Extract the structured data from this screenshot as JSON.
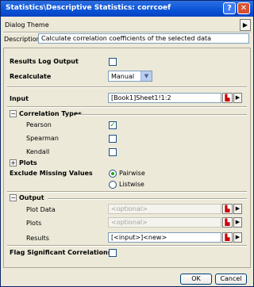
{
  "window": {
    "title": "Statistics\\Descriptive Statistics: corrcoef"
  },
  "title_buttons": {
    "help": "?",
    "close": "✕"
  },
  "dialog_theme": {
    "label": "Dialog Theme",
    "arrow": "▶"
  },
  "description": {
    "label": "Description",
    "value": "Calculate correlation coefficients of the selected data"
  },
  "results_log": {
    "label": "Results Log Output",
    "checked": false
  },
  "recalculate": {
    "label": "Recalculate",
    "value": "Manual",
    "arrow": "▼"
  },
  "input": {
    "label": "Input",
    "value": "[Book1]Sheet1!1:2"
  },
  "correlation_types": {
    "header": "Correlation Types",
    "expander": "−",
    "pearson": {
      "label": "Pearson",
      "checked": true,
      "mark": "✓"
    },
    "spearman": {
      "label": "Spearman",
      "checked": false
    },
    "kendall": {
      "label": "Kendall",
      "checked": false
    }
  },
  "plots_section": {
    "header": "Plots",
    "expander": "+"
  },
  "exclude_missing": {
    "label": "Exclude Missing Values",
    "options": [
      "Pairwise",
      "Listwise"
    ],
    "selected": "Pairwise"
  },
  "output": {
    "header": "Output",
    "expander": "−",
    "plot_data": {
      "label": "Plot Data",
      "value": "<optional>"
    },
    "plots": {
      "label": "Plots",
      "value": "<optional>"
    },
    "results": {
      "label": "Results",
      "value": "[<input>]<new>"
    }
  },
  "flag_significant": {
    "label": "Flag Significant Correlations",
    "checked": false
  },
  "buttons": {
    "ok": "OK",
    "cancel": "Cancel"
  },
  "icons": {
    "picker": "▙",
    "arrow": "▶"
  }
}
